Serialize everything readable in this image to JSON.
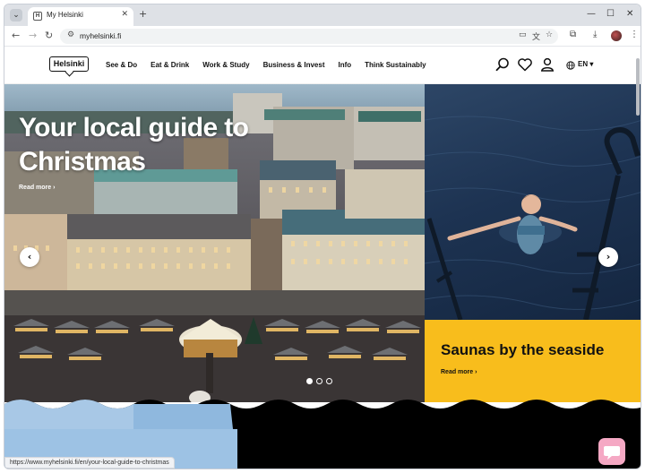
{
  "browser": {
    "tab_title": "My Helsinki",
    "tab_favicon_letter": "H",
    "url": "myhelsinki.fi",
    "status_url": "https://www.myhelsinki.fi/en/your-local-guide-to-christmas"
  },
  "site": {
    "logo_text": "Helsinki",
    "nav": [
      "See & Do",
      "Eat & Drink",
      "Work & Study",
      "Business & Invest",
      "Info",
      "Think Sustainably"
    ],
    "language": "EN"
  },
  "hero": {
    "main_title": "Your local guide to Christmas",
    "main_more": "Read more ›",
    "side_title": "Saunas by the seaside",
    "side_more": "Read more ›",
    "slide_count": 3,
    "active_slide": 1
  },
  "colors": {
    "card_yellow": "#f8bd1c",
    "chat_pink": "#f5a8c4",
    "water": "#1d3352"
  },
  "icons": {
    "search": "search-icon",
    "favorites": "heart-icon",
    "account": "user-icon",
    "language": "globe-icon",
    "carousel_prev": "arrow-left-icon",
    "carousel_next": "arrow-right-icon",
    "chat": "chat-icon"
  }
}
